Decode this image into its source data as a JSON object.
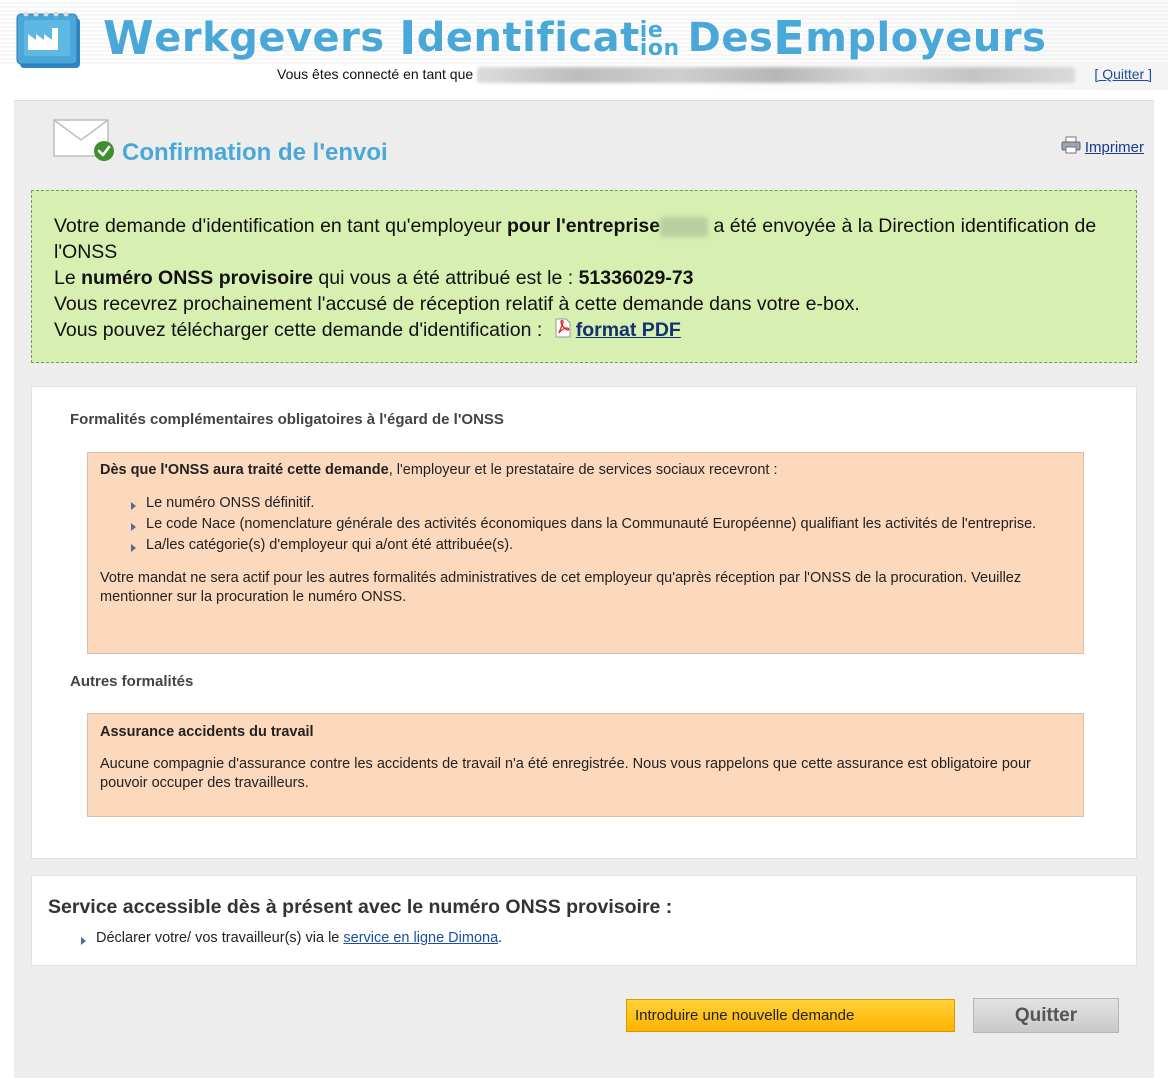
{
  "header": {
    "title_parts": {
      "w": "W",
      "erkgevers": "erkgevers ",
      "i": "I",
      "dentificat": "dentificat",
      "ie": "ie",
      "ion": "ion",
      "des": " Des ",
      "e": "E",
      "mployeurs": "mployeurs"
    },
    "logged_in_text": "Vous êtes connecté en tant que",
    "quit_link": "[ Quitter ]",
    "title_color": "#4aa8d8"
  },
  "page": {
    "title": "Confirmation de l'envoi",
    "print_label": "Imprimer"
  },
  "confirmation": {
    "line1_a": "Votre demande d'identification en tant qu'employeur ",
    "line1_b": "pour l'entreprise",
    "line1_c": " a été envoyée à la Direction identification de l'ONSS",
    "line2_a": "Le ",
    "line2_b": "numéro ONSS provisoire",
    "line2_c": " qui vous a été attribué est le : ",
    "onss_number": "51336029-73",
    "line3": "Vous recevrez prochainement l'accusé de réception relatif à cette demande dans votre e-box.",
    "line4": "Vous pouvez télécharger cette demande d'identification : ",
    "pdf_link": "format PDF",
    "bg_color": "#d7efb1"
  },
  "formalities": {
    "heading": "Formalités complémentaires obligatoires à l'égard de l'ONSS",
    "intro_bold": "Dès que l'ONSS aura traité cette demande",
    "intro_rest": ", l'employeur et le prestataire de services sociaux recevront :",
    "items": [
      "Le numéro ONSS définitif.",
      "Le code Nace (nomenclature générale des activités économiques dans la Communauté Européenne) qualifiant les activités de l'entreprise.",
      "La/les catégorie(s) d'employeur qui a/ont été attribuée(s)."
    ],
    "note": "Votre mandat ne sera actif pour les autres formalités administratives de cet employeur qu'après réception par l'ONSS de la procuration. Veuillez mentionner sur la procuration le numéro ONSS.",
    "box_color": "#fcd9bd"
  },
  "other": {
    "heading": "Autres formalités",
    "box_title": "Assurance accidents du travail",
    "box_text": "Aucune compagnie d'assurance contre les accidents de travail n'a été enregistrée. Nous vous rappelons que cette assurance est obligatoire pour pouvoir occuper des travailleurs."
  },
  "service": {
    "title": "Service accessible dès à présent avec le numéro ONSS provisoire :",
    "item_prefix": "Déclarer votre/ vos travailleur(s) via le ",
    "item_link": "service en ligne Dimona",
    "item_suffix": "."
  },
  "buttons": {
    "new_request": "Introduire une nouvelle demande",
    "quit": "Quitter",
    "new_request_color": "#ffc107"
  },
  "icons": {
    "logo": "factory-form-icon",
    "envelope": "envelope-check-icon",
    "print": "printer-icon",
    "pdf": "pdf-file-icon"
  }
}
